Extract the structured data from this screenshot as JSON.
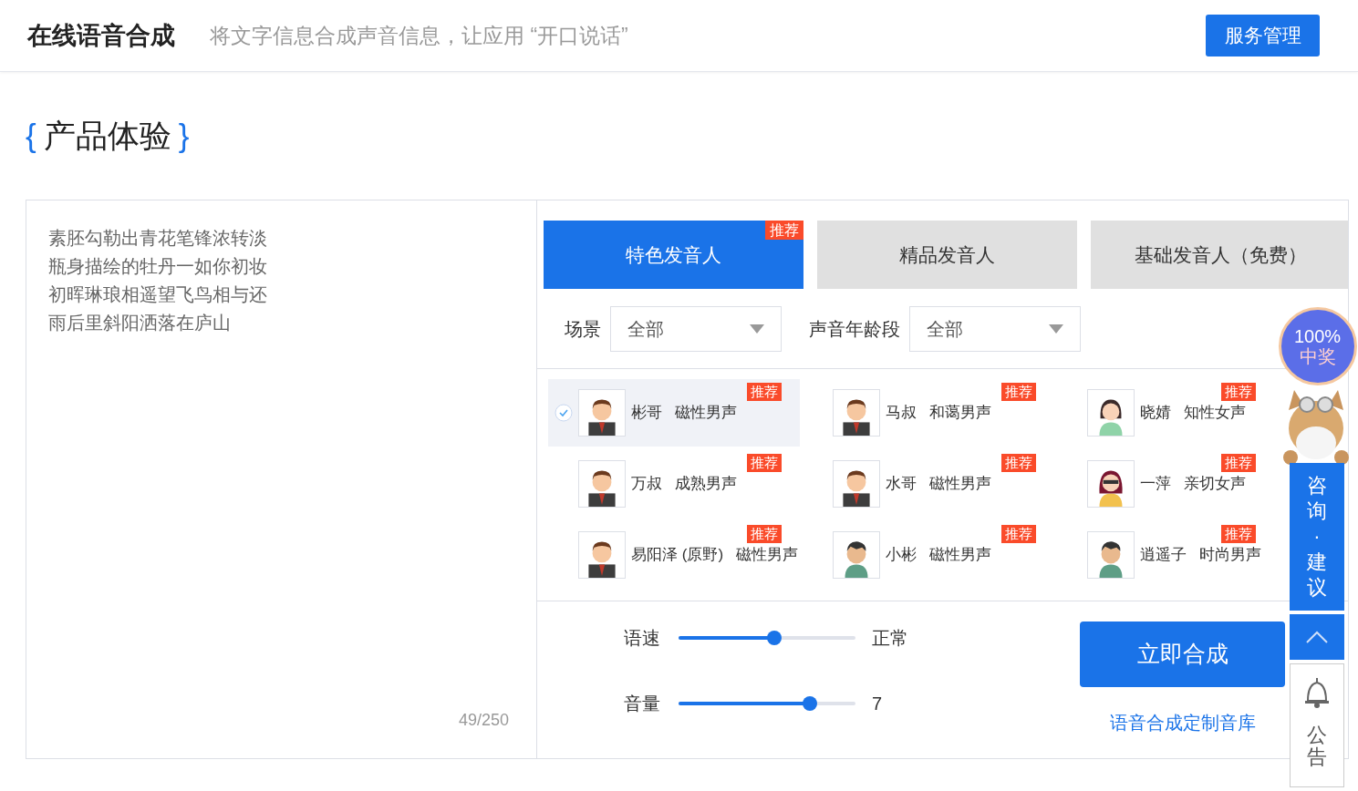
{
  "header": {
    "title": "在线语音合成",
    "subtitle": "将文字信息合成声音信息，让应用 “开口说话”",
    "button": "服务管理"
  },
  "section_title": {
    "open": "{",
    "text": "产品体验",
    "close": "}"
  },
  "editor": {
    "lines": [
      "素胚勾勒出青花笔锋浓转淡",
      "瓶身描绘的牡丹一如你初妆",
      "初晖琳琅相遥望飞鸟相与还",
      "雨后里斜阳洒落在庐山"
    ],
    "counter": "49/250"
  },
  "tabs": [
    {
      "label": "特色发音人",
      "selected": true,
      "badge": "推荐"
    },
    {
      "label": "精品发音人",
      "selected": false
    },
    {
      "label": "基础发音人（免费）",
      "selected": false
    }
  ],
  "filters": [
    {
      "label": "场景",
      "value": "全部"
    },
    {
      "label": "声音年龄段",
      "value": "全部"
    }
  ],
  "voices": [
    {
      "name": "彬哥",
      "desc": "磁性男声",
      "selected": true,
      "badge": "推荐",
      "kind": "man"
    },
    {
      "name": "马叔",
      "desc": "和蔼男声",
      "selected": false,
      "badge": "推荐",
      "kind": "man"
    },
    {
      "name": "晓婧",
      "desc": "知性女声",
      "selected": false,
      "badge": "推荐",
      "kind": "woman"
    },
    {
      "name": "万叔",
      "desc": "成熟男声",
      "selected": false,
      "badge": "推荐",
      "kind": "man"
    },
    {
      "name": "水哥",
      "desc": "磁性男声",
      "selected": false,
      "badge": "推荐",
      "kind": "man"
    },
    {
      "name": "一萍",
      "desc": "亲切女声",
      "selected": false,
      "badge": "推荐",
      "kind": "woman-glasses"
    },
    {
      "name": "易阳泽 (原野)",
      "desc": "磁性男声",
      "selected": false,
      "badge": "推荐",
      "kind": "man"
    },
    {
      "name": "小彬",
      "desc": "磁性男声",
      "selected": false,
      "badge": "推荐",
      "kind": "boy"
    },
    {
      "name": "逍遥子",
      "desc": "时尚男声",
      "selected": false,
      "badge": "推荐",
      "kind": "boy"
    }
  ],
  "sliders": [
    {
      "label": "语速",
      "level": 0.54,
      "reading": "正常"
    },
    {
      "label": "音量",
      "level": 0.74,
      "reading": "7"
    }
  ],
  "synthesize_button": "立即合成",
  "custom_link": "语音合成定制音库",
  "float_bar": {
    "promo": [
      "100%",
      "中奖"
    ],
    "consult": [
      "咨",
      "询",
      "·",
      "建",
      "议"
    ],
    "notice": [
      "公",
      "告"
    ]
  }
}
